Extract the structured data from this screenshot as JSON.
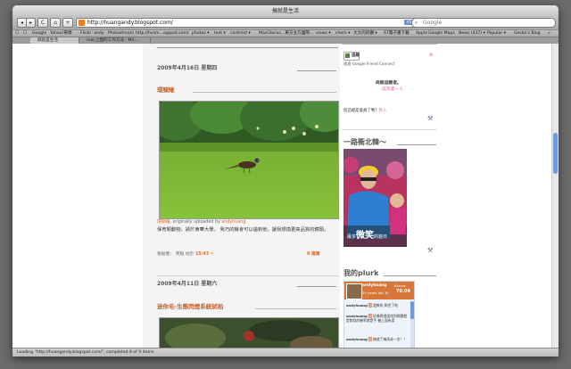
{
  "window": {
    "title": "搞就是生活"
  },
  "nav": {
    "back": "◂",
    "forward": "▸",
    "reload": "C",
    "home": "⌂",
    "add": "+"
  },
  "address": {
    "url": "http://huangandy.blogspot.com/",
    "rss": "RSS"
  },
  "search": {
    "placeholder": "Google"
  },
  "bookmarks": [
    "Google",
    "Yahoo!奇摩",
    "Flickr: andy · Photostream",
    "http://hvsm…ogspot.com/",
    "photos ▾",
    "text ▾",
    "contract ▾",
    "MacGlocus…東方主方國際…",
    "views ▾",
    "chem ▾",
    "大大的的鑽 ▾",
    "ST電子書下載",
    "Apple",
    "Google Maps",
    "News (437) ▾",
    "Popular ▾",
    "Gecko's Blog"
  ],
  "tabs": [
    "搞就是生活",
    "mac上面的工作方法 - MA…"
  ],
  "post1": {
    "date": "2009年4月16日 星期四",
    "title": "環頸雉",
    "caption_name": "環頸雉",
    "caption_mid": ", originally uploaded by ",
    "caption_user": "andyhuang",
    "body": "保育類動物，請於東華大學。 我巧的機會可以遇到他，讓我想換更高品質的鏡頭。",
    "meta_prefix": "張貼者： 笑點 佐於",
    "time": "15:43",
    "comments": "0 篇資"
  },
  "post2": {
    "date": "2009年4月11日 星期六",
    "title": "迷你毛-生態閃燈系統試拍"
  },
  "sidebar": {
    "gfc_label": "追蹤",
    "gfc_sub": "透過 Google Friend Connect",
    "followers_line1": "尚無追蹤者。",
    "followers_line2": "成為第一人",
    "member_q": "您已經是會員了嗎？",
    "member_link": "登入",
    "north_title": "一路衝北韓～",
    "photo_caption": "微笑",
    "photo_caption_small": "最多",
    "photo_caption_after": "的遊日",
    "plurk_title": "我的plurk",
    "plurk_user": "andyhuang",
    "plurk_meta": "Karma:",
    "plurk_karma": "70.04",
    "plurk_since": "25 years old, M.",
    "entries": [
      {
        "user": "andyhuang",
        "text": "超爽的 幹完了啦"
      },
      {
        "user": "andyhuang",
        "text": "好像閃燈誤找到問題就是剛其的機率就是手 機上面有用"
      },
      {
        "user": "andyhuang",
        "text": "搞就了搞再拿一次！！"
      }
    ]
  },
  "status": {
    "text": "Loading \"http://huangandy.blogspot.com/\", completed 8 of 9 items"
  },
  "colors": {
    "accent": "#e06a2c",
    "link": "#e06a8c",
    "scroll": "#6f9bdc"
  }
}
